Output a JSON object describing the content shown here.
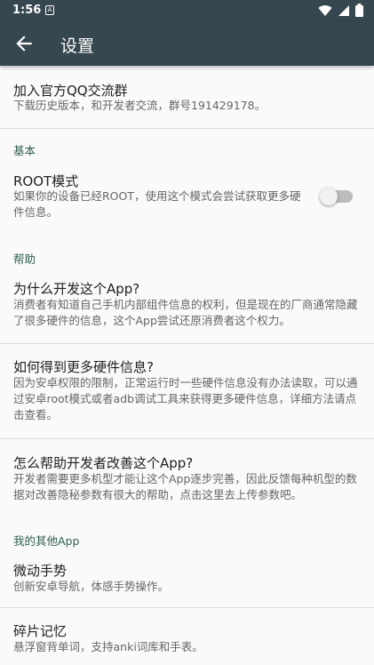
{
  "status": {
    "time": "1:56",
    "notification_glyph": "A"
  },
  "toolbar": {
    "title": "设置",
    "back_icon": "arrow-back-icon"
  },
  "items": {
    "qq_group": {
      "title": "加入官方QQ交流群",
      "summary": "下载历史版本，和开发者交流，群号191429178。"
    },
    "root_mode": {
      "title": "ROOT模式",
      "summary": "如果你的设备已经ROOT，使用这个模式会尝试获取更多硬件信息。",
      "enabled": false
    },
    "why_app": {
      "title": "为什么开发这个App?",
      "summary": "消费者有知道自己手机内部组件信息的权利，但是现在的厂商通常隐藏了很多硬件的信息，这个App尝试还原消费者这个权力。"
    },
    "more_info": {
      "title": "如何得到更多硬件信息?",
      "summary": "因为安卓权限的限制，正常运行时一些硬件信息没有办法读取，可以通过安卓root模式或者adb调试工具来获得更多硬件信息，详细方法请点击查看。"
    },
    "help_dev": {
      "title": "怎么帮助开发者改善这个App?",
      "summary": "开发者需要更多机型才能让这个App逐步完善，因此反馈每种机型的数据对改善隐秘参数有很大的帮助，点击这里去上传参数吧。"
    },
    "gesture": {
      "title": "微动手势",
      "summary": "创新安卓导航，体感手势操作。"
    },
    "fragment": {
      "title": "碎片记忆",
      "summary": "悬浮窗背单词，支持anki词库和手表。"
    }
  },
  "categories": {
    "basic": "基本",
    "help": "帮助",
    "other_apps": "我的其他App"
  },
  "colors": {
    "toolbar": "#37474f",
    "category": "#2e5f52",
    "background": "#fafafa"
  }
}
